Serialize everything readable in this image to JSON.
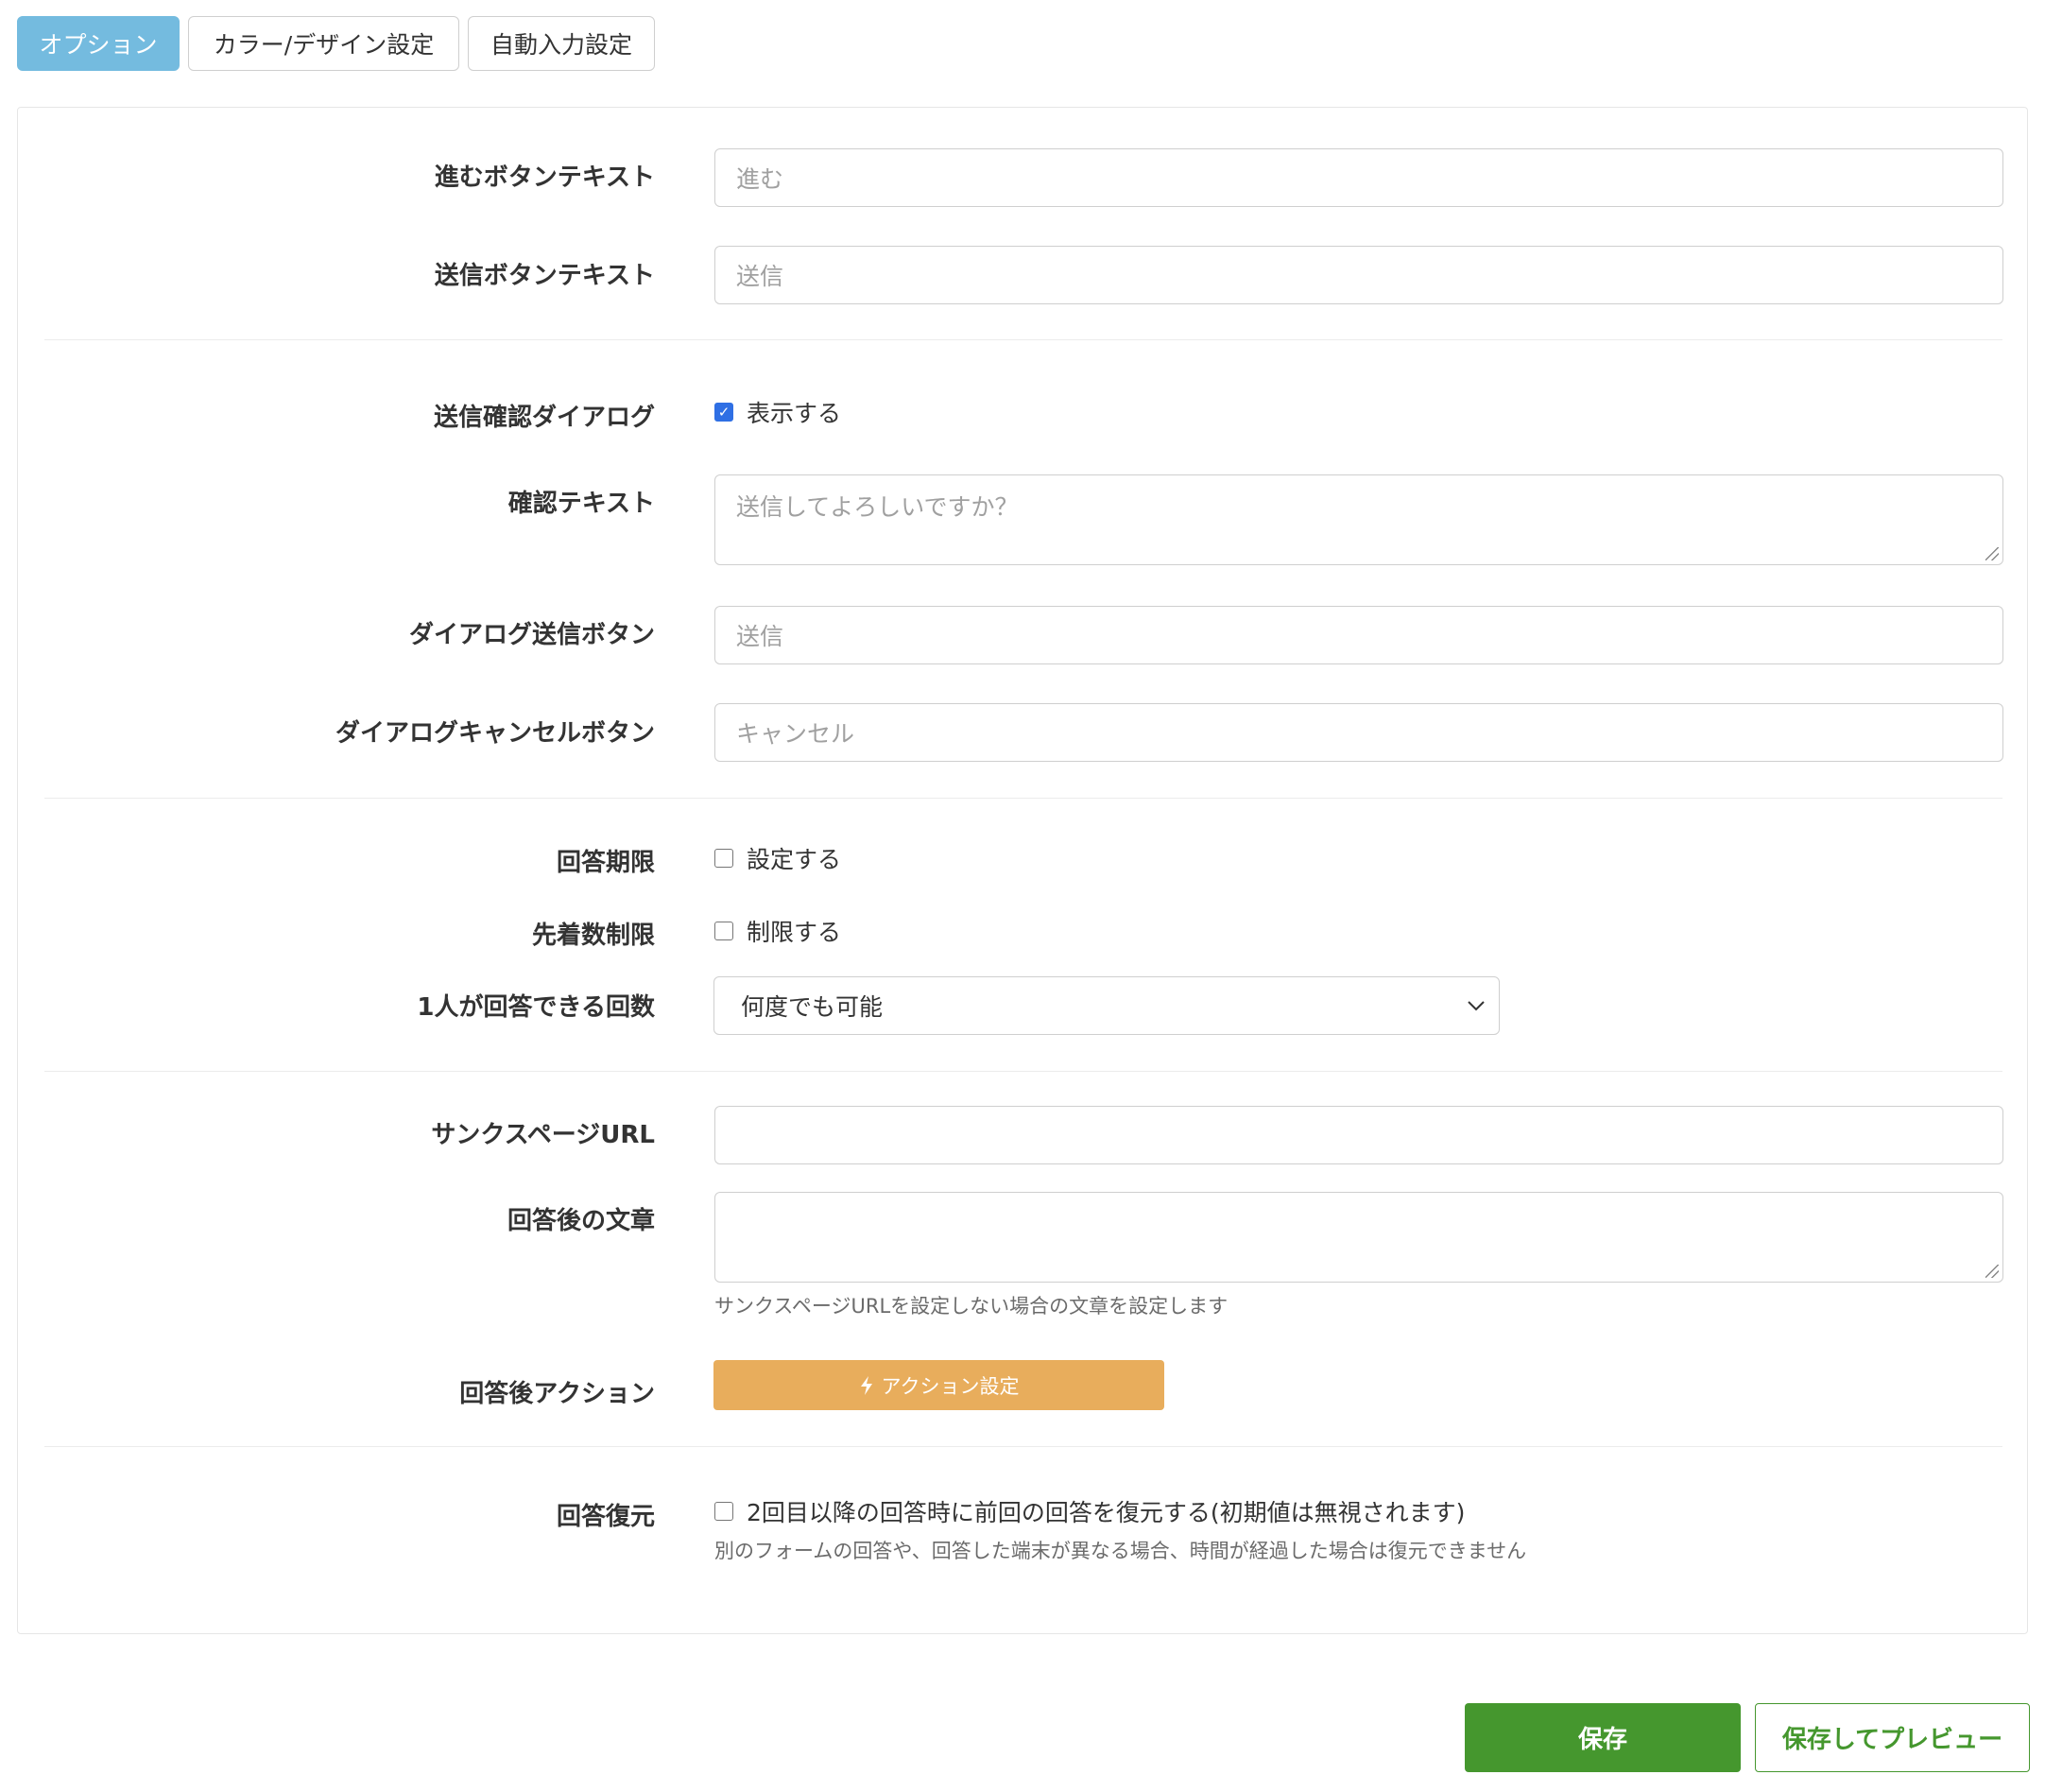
{
  "tabs": [
    {
      "label": "オプション",
      "active": true
    },
    {
      "label": "カラー/デザイン設定",
      "active": false
    },
    {
      "label": "自動入力設定",
      "active": false
    }
  ],
  "form": {
    "next_button_text": {
      "label": "進むボタンテキスト",
      "placeholder": "進む",
      "value": ""
    },
    "submit_button_text": {
      "label": "送信ボタンテキスト",
      "placeholder": "送信",
      "value": ""
    },
    "confirm_dialog": {
      "label": "送信確認ダイアログ",
      "checkbox_label": "表示する",
      "checked": true
    },
    "confirm_text": {
      "label": "確認テキスト",
      "placeholder": "送信してよろしいですか？",
      "value": ""
    },
    "dialog_submit_button": {
      "label": "ダイアログ送信ボタン",
      "placeholder": "送信",
      "value": ""
    },
    "dialog_cancel_button": {
      "label": "ダイアログキャンセルボタン",
      "placeholder": "キャンセル",
      "value": ""
    },
    "answer_deadline": {
      "label": "回答期限",
      "checkbox_label": "設定する",
      "checked": false
    },
    "first_come_limit": {
      "label": "先着数制限",
      "checkbox_label": "制限する",
      "checked": false
    },
    "answers_per_person": {
      "label": "1人が回答できる回数",
      "selected": "何度でも可能"
    },
    "thanks_page_url": {
      "label": "サンクスページURL",
      "value": ""
    },
    "after_answer_text": {
      "label": "回答後の文章",
      "value": "",
      "help": "サンクスページURLを設定しない場合の文章を設定します"
    },
    "after_answer_action": {
      "label": "回答後アクション",
      "button_label": "アクション設定",
      "icon": "lightning-icon"
    },
    "answer_restore": {
      "label": "回答復元",
      "checkbox_label": "2回目以降の回答時に前回の回答を復元する(初期値は無視されます)",
      "checked": false,
      "help": "別のフォームの回答や、回答した端末が異なる場合、時間が経過した場合は復元できません"
    }
  },
  "footer": {
    "save_label": "保存",
    "save_preview_label": "保存してプレビュー"
  },
  "colors": {
    "active_tab": "#74bbdf",
    "action_button": "#e8ad5c",
    "save_button": "#45972e",
    "checkbox_checked": "#2f6fe4"
  }
}
